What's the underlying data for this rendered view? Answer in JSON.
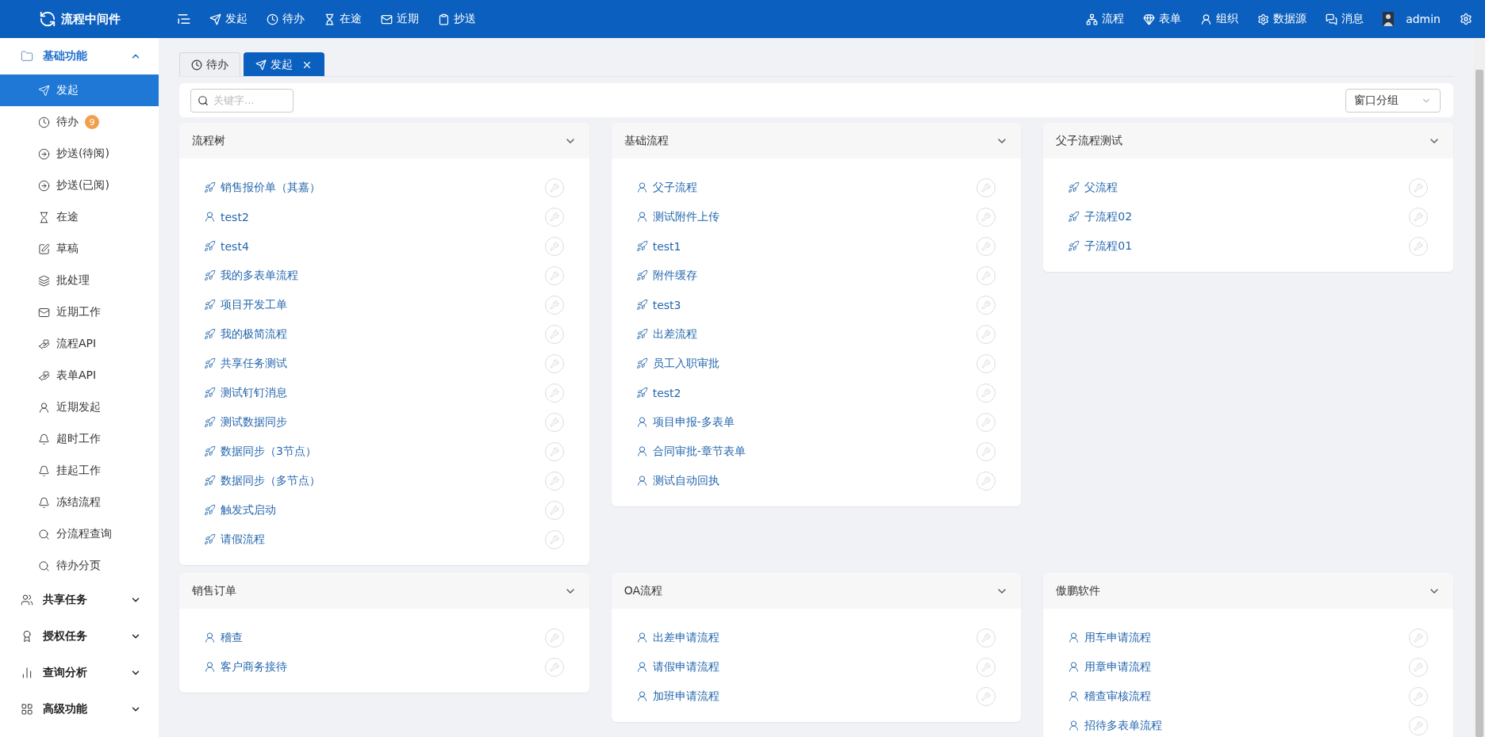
{
  "app": {
    "title": "流程中间件"
  },
  "top_nav": [
    {
      "label": "发起"
    },
    {
      "label": "待办"
    },
    {
      "label": "在途"
    },
    {
      "label": "近期"
    },
    {
      "label": "抄送"
    }
  ],
  "top_right": [
    {
      "label": "流程"
    },
    {
      "label": "表单"
    },
    {
      "label": "组织"
    },
    {
      "label": "数据源"
    },
    {
      "label": "消息"
    }
  ],
  "user": {
    "name": "admin"
  },
  "sidebar": {
    "groups": [
      {
        "label": "基础功能",
        "expanded": true,
        "items": [
          {
            "label": "发起",
            "selected": true
          },
          {
            "label": "待办",
            "selected": false,
            "badge": "9"
          },
          {
            "label": "抄送(待阅)",
            "selected": false
          },
          {
            "label": "抄送(已阅)",
            "selected": false
          },
          {
            "label": "在途",
            "selected": false
          },
          {
            "label": "草稿",
            "selected": false
          },
          {
            "label": "批处理",
            "selected": false
          },
          {
            "label": "近期工作",
            "selected": false
          },
          {
            "label": "流程API",
            "selected": false
          },
          {
            "label": "表单API",
            "selected": false
          },
          {
            "label": "近期发起",
            "selected": false
          },
          {
            "label": "超时工作",
            "selected": false
          },
          {
            "label": "挂起工作",
            "selected": false
          },
          {
            "label": "冻结流程",
            "selected": false
          },
          {
            "label": "分流程查询",
            "selected": false
          },
          {
            "label": "待办分页",
            "selected": false
          }
        ]
      },
      {
        "label": "共享任务",
        "expanded": false
      },
      {
        "label": "授权任务",
        "expanded": false
      },
      {
        "label": "查询分析",
        "expanded": false
      },
      {
        "label": "高级功能",
        "expanded": false
      }
    ]
  },
  "tabs": [
    {
      "label": "待办",
      "selected": false,
      "closable": false
    },
    {
      "label": "发起",
      "selected": true,
      "closable": true
    }
  ],
  "search": {
    "placeholder": "关键字..."
  },
  "group_select": {
    "value": "窗口分组"
  },
  "cards": [
    {
      "title": "流程树",
      "items": [
        {
          "label": "销售报价单（其嘉）",
          "kind": "rocket"
        },
        {
          "label": "test2",
          "kind": "user"
        },
        {
          "label": "test4",
          "kind": "rocket"
        },
        {
          "label": "我的多表单流程",
          "kind": "rocket"
        },
        {
          "label": "项目开发工单",
          "kind": "rocket"
        },
        {
          "label": "我的极简流程",
          "kind": "rocket"
        },
        {
          "label": "共享任务测试",
          "kind": "rocket"
        },
        {
          "label": "测试钉钉消息",
          "kind": "rocket"
        },
        {
          "label": "测试数据同步",
          "kind": "rocket"
        },
        {
          "label": "数据同步（3节点）",
          "kind": "rocket"
        },
        {
          "label": "数据同步（多节点）",
          "kind": "rocket"
        },
        {
          "label": "触发式启动",
          "kind": "rocket"
        },
        {
          "label": "请假流程",
          "kind": "rocket"
        }
      ]
    },
    {
      "title": "基础流程",
      "items": [
        {
          "label": "父子流程",
          "kind": "user"
        },
        {
          "label": "测试附件上传",
          "kind": "user"
        },
        {
          "label": "test1",
          "kind": "rocket"
        },
        {
          "label": "附件缓存",
          "kind": "rocket"
        },
        {
          "label": "test3",
          "kind": "rocket"
        },
        {
          "label": "出差流程",
          "kind": "rocket"
        },
        {
          "label": "员工入职审批",
          "kind": "rocket"
        },
        {
          "label": "test2",
          "kind": "rocket"
        },
        {
          "label": "项目申报-多表单",
          "kind": "user"
        },
        {
          "label": "合同审批-章节表单",
          "kind": "user"
        },
        {
          "label": "测试自动回执",
          "kind": "user"
        }
      ]
    },
    {
      "title": "父子流程测试",
      "items": [
        {
          "label": "父流程",
          "kind": "rocket"
        },
        {
          "label": "子流程02",
          "kind": "rocket"
        },
        {
          "label": "子流程01",
          "kind": "rocket"
        }
      ]
    },
    {
      "title": "销售订单",
      "items": [
        {
          "label": "稽查",
          "kind": "user"
        },
        {
          "label": "客户商务接待",
          "kind": "user"
        }
      ]
    },
    {
      "title": "OA流程",
      "items": [
        {
          "label": "出差申请流程",
          "kind": "user"
        },
        {
          "label": "请假申请流程",
          "kind": "user"
        },
        {
          "label": "加班申请流程",
          "kind": "user"
        }
      ]
    },
    {
      "title": "傲鹏软件",
      "items": [
        {
          "label": "用车申请流程",
          "kind": "user"
        },
        {
          "label": "用章申请流程",
          "kind": "user"
        },
        {
          "label": "稽查审核流程",
          "kind": "user"
        },
        {
          "label": "招待多表单流程",
          "kind": "user"
        }
      ]
    }
  ]
}
